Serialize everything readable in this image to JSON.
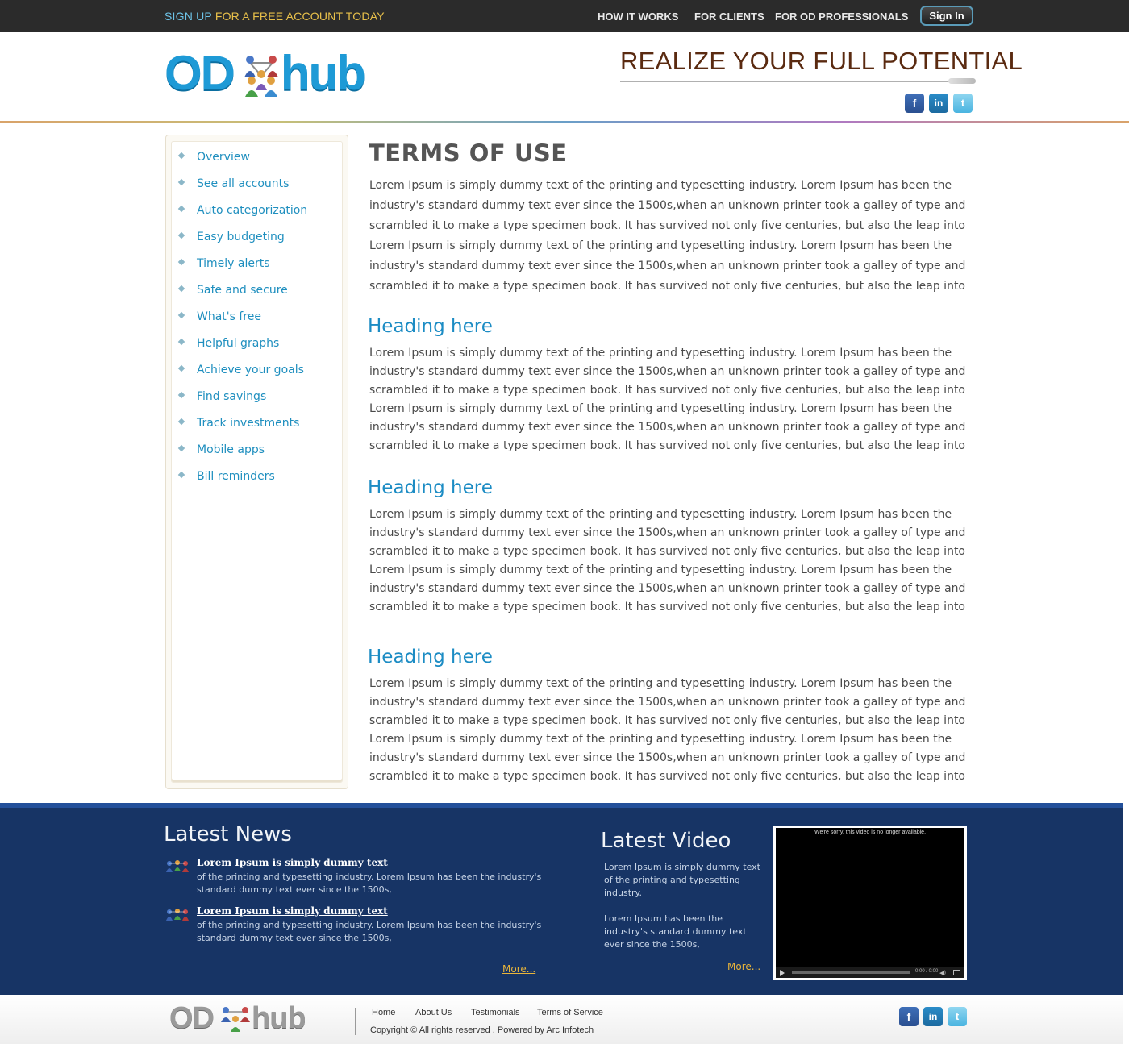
{
  "topbar": {
    "signup_part1": "SIGN UP",
    "signup_part2": "FOR A FREE ACCOUNT TODAY",
    "nav": [
      "HOW IT WORKS",
      "FOR CLIENTS",
      "FOR OD PROFESSIONALS"
    ],
    "signin_label": "Sign In"
  },
  "header": {
    "logo_left": "OD",
    "logo_right": "hub",
    "tagline": "REALIZE YOUR FULL POTENTIAL",
    "social_icons": [
      "facebook-icon",
      "linkedin-icon",
      "twitter-icon"
    ],
    "social_glyphs": {
      "facebook": "f",
      "linkedin": "in",
      "twitter": "t"
    }
  },
  "sidebar": {
    "items": [
      "Overview",
      "See all accounts",
      "Auto categorization",
      "Easy budgeting",
      "Timely alerts",
      "Safe and secure",
      "What's free",
      "Helpful graphs",
      "Achieve your goals",
      "Find savings",
      "Track investments",
      "Mobile apps",
      "Bill reminders"
    ]
  },
  "main": {
    "title": "TERMS OF USE",
    "intro": "Lorem Ipsum is simply dummy text of the printing and typesetting industry. Lorem Ipsum has been the industry's standard dummy text ever since the 1500s,when an unknown printer took a galley of type and scrambled it to make a type specimen book. It has survived not only five centuries, but also the leap into Lorem Ipsum is simply dummy text of the printing and typesetting industry. Lorem Ipsum has been the industry's standard dummy text ever since the 1500s,when an unknown printer took a galley of type and scrambled it to make a type specimen book. It has survived not only five centuries, but also the leap into",
    "sections": [
      {
        "heading": "Heading here",
        "body": "Lorem Ipsum is simply dummy text of the printing and typesetting industry. Lorem Ipsum has been the industry's standard dummy text ever since the 1500s,when an unknown printer took a galley of type and scrambled it to make a type specimen book. It has survived not only five centuries, but also the leap into Lorem Ipsum is simply dummy text of the printing and typesetting industry. Lorem Ipsum has been the industry's standard dummy text ever since the 1500s,when an unknown printer took a galley of type and scrambled it to make a type specimen book. It has survived not only five centuries, but also the leap into"
      },
      {
        "heading": "Heading here",
        "body": "Lorem Ipsum is simply dummy text of the printing and typesetting industry. Lorem Ipsum has been the industry's standard dummy text ever since the 1500s,when an unknown printer took a galley of type and scrambled it to make a type specimen book. It has survived not only five centuries, but also the leap into Lorem Ipsum is simply dummy text of the printing and typesetting industry. Lorem Ipsum has been the industry's standard dummy text ever since the 1500s,when an unknown printer took a galley of type and scrambled it to make a type specimen book. It has survived not only five centuries, but also the leap into"
      },
      {
        "heading": "Heading here",
        "body": "Lorem Ipsum is simply dummy text of the printing and typesetting industry. Lorem Ipsum has been the industry's standard dummy text ever since the 1500s,when an unknown printer took a galley of type and scrambled it to make a type specimen book. It has survived not only five centuries, but also the leap into Lorem Ipsum is simply dummy text of the printing and typesetting industry. Lorem Ipsum has been the industry's standard dummy text ever since the 1500s,when an unknown printer took a galley of type and scrambled it to make a type specimen book. It has survived not only five centuries, but also the leap into"
      }
    ]
  },
  "latest_news": {
    "heading": "Latest News",
    "items": [
      {
        "title": "Lorem Ipsum is simply dummy text",
        "text": "of the printing and typesetting industry. Lorem Ipsum has been the industry's standard dummy text ever since the 1500s,"
      },
      {
        "title": "Lorem Ipsum is simply dummy text",
        "text": "of the printing and typesetting industry. Lorem Ipsum has been the industry's standard dummy text ever since the 1500s,"
      }
    ],
    "more": "More..."
  },
  "latest_video": {
    "heading": "Latest Video",
    "text1": "Lorem Ipsum is simply dummy text of the printing and typesetting industry.",
    "text2": "Lorem Ipsum has been the industry's standard dummy text ever since the 1500s,",
    "more": "More...",
    "player_message": "We're sorry, this video is no longer available.",
    "player_time": "0:00 / 0:00"
  },
  "footer": {
    "logo_left": "OD",
    "logo_right": "hub",
    "links": [
      "Home",
      "About Us",
      "Testimonials",
      "Terms of Service"
    ],
    "copyright_text": "Copyright ©   All rights reserved . Powered by",
    "company": "Arc Infotech"
  },
  "colors": {
    "topbar_bg": "#2b2b2b",
    "accent_blue": "#1c8cc4",
    "band_bg": "#173465",
    "more_link": "#e8b43a",
    "tagline": "#5a2a10"
  }
}
